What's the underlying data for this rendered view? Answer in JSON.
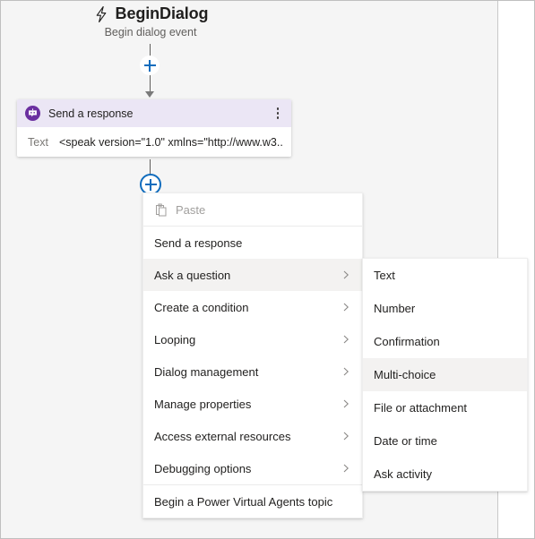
{
  "trigger": {
    "icon": "lightning-bolt-icon",
    "title": "BeginDialog",
    "subtitle": "Begin dialog event"
  },
  "node_card": {
    "icon": "bot-message-icon",
    "title": "Send a response",
    "more_icon": "more-vertical-icon",
    "field_label": "Text",
    "field_value": "<speak version=\"1.0\" xmlns=\"http://www.w3...."
  },
  "add_buttons": {
    "top_label": "+",
    "bottom_label": "+"
  },
  "context_menu": {
    "items": [
      {
        "label": "Paste",
        "icon": "paste-icon",
        "disabled": true,
        "submenu": false,
        "highlight": false
      },
      {
        "label": "Send a response",
        "disabled": false,
        "submenu": false,
        "highlight": false
      },
      {
        "label": "Ask a question",
        "disabled": false,
        "submenu": true,
        "highlight": true
      },
      {
        "label": "Create a condition",
        "disabled": false,
        "submenu": true,
        "highlight": false
      },
      {
        "label": "Looping",
        "disabled": false,
        "submenu": true,
        "highlight": false
      },
      {
        "label": "Dialog management",
        "disabled": false,
        "submenu": true,
        "highlight": false
      },
      {
        "label": "Manage properties",
        "disabled": false,
        "submenu": true,
        "highlight": false
      },
      {
        "label": "Access external resources",
        "disabled": false,
        "submenu": true,
        "highlight": false
      },
      {
        "label": "Debugging options",
        "disabled": false,
        "submenu": true,
        "highlight": false
      },
      {
        "label": "Begin a Power Virtual Agents topic",
        "disabled": false,
        "submenu": false,
        "highlight": false
      }
    ]
  },
  "submenu": {
    "parent": "Ask a question",
    "items": [
      {
        "label": "Text",
        "highlight": false
      },
      {
        "label": "Number",
        "highlight": false
      },
      {
        "label": "Confirmation",
        "highlight": false
      },
      {
        "label": "Multi-choice",
        "highlight": true
      },
      {
        "label": "File or attachment",
        "highlight": false
      },
      {
        "label": "Date or time",
        "highlight": false
      },
      {
        "label": "Ask activity",
        "highlight": false
      }
    ]
  },
  "colors": {
    "canvas_bg": "#f5f5f5",
    "accent_blue": "#0f6cbd",
    "node_purple": "#6b2fa0",
    "node_header_tint": "#ebe6f5",
    "menu_highlight": "#f3f2f1"
  }
}
